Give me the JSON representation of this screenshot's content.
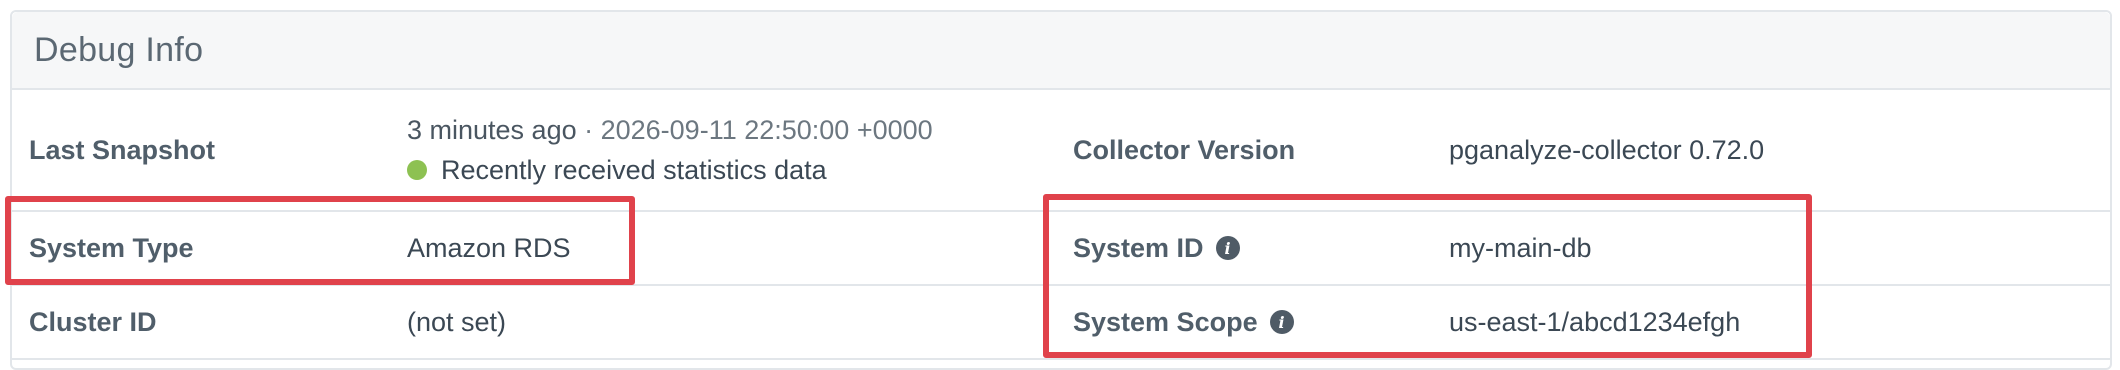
{
  "panel": {
    "title": "Debug Info"
  },
  "rows": {
    "last_snapshot": {
      "label": "Last Snapshot",
      "relative": "3 minutes ago",
      "separator": " · ",
      "absolute": "2026-09-11 22:50:00 +0000",
      "status_text": "Recently received statistics data",
      "status_color": "#8dc152"
    },
    "collector_version": {
      "label": "Collector Version",
      "value": "pganalyze-collector 0.72.0"
    },
    "system_type": {
      "label": "System Type",
      "value": "Amazon RDS"
    },
    "system_id": {
      "label": "System ID",
      "value": "my-main-db",
      "icon": "info-icon"
    },
    "cluster_id": {
      "label": "Cluster ID",
      "value": "(not set)"
    },
    "system_scope": {
      "label": "System Scope",
      "value": "us-east-1/abcd1234efgh",
      "icon": "info-icon"
    }
  },
  "colors": {
    "highlight": "#e0424b",
    "header_bg": "#f6f7f8",
    "border": "#e2e6ea"
  }
}
